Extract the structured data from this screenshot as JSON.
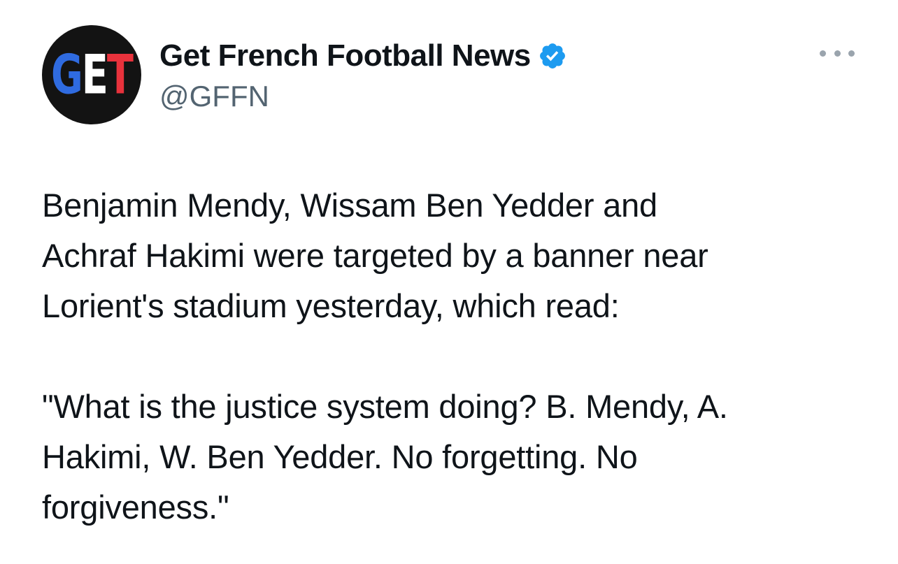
{
  "author": {
    "display_name": "Get French Football News",
    "handle": "@GFFN",
    "avatar_letters": [
      "G",
      "E",
      "T"
    ],
    "avatar_colors": [
      "#2f6be0",
      "#ffffff",
      "#e8323c"
    ],
    "verified_icon": "verified-badge-icon",
    "verified_color": "#1d9bf0"
  },
  "more_menu_icon": "more-horizontal-icon",
  "tweet": {
    "text": "Benjamin Mendy, Wissam Ben Yedder and\nAchraf Hakimi were targeted by a banner near\nLorient's stadium yesterday, which read:\n\n\"What is the justice system doing? B. Mendy, A.\nHakimi, W. Ben Yedder. No forgetting. No\nforgiveness.\""
  }
}
